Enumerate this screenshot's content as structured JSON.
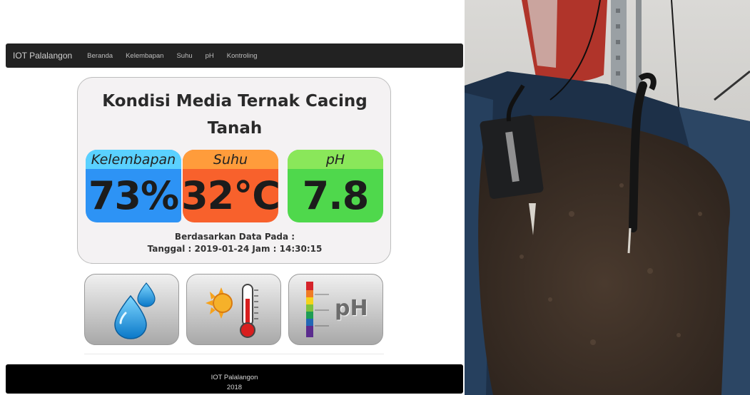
{
  "navbar": {
    "brand": "IOT Palalangon",
    "items": [
      "Beranda",
      "Kelembapan",
      "Suhu",
      "pH",
      "Kontroling"
    ]
  },
  "card": {
    "title_line1": "Kondisi Media Ternak Cacing",
    "title_line2": "Tanah",
    "tiles": [
      {
        "label": "Kelembapan",
        "value": "73%"
      },
      {
        "label": "Suhu",
        "value": "32°C"
      },
      {
        "label": "pH",
        "value": "7.8"
      }
    ],
    "info_line1": "Berdasarkan Data Pada :",
    "info_line2": "Tanggal : 2019-01-24 Jam : 14:30:15"
  },
  "icons": [
    {
      "name": "water-drop-icon"
    },
    {
      "name": "sun-thermometer-icon"
    },
    {
      "name": "ph-scale-icon",
      "text": "pH"
    }
  ],
  "footer": {
    "line1": "IOT Palalangon",
    "line2": "2018"
  },
  "colors": {
    "kelembapan_head": "#5ad1ff",
    "kelembapan_body": "#2d93f5",
    "suhu_head": "#ff9c3b",
    "suhu_body": "#f8612c",
    "ph_head": "#8ae75a",
    "ph_body": "#4fd84c"
  }
}
